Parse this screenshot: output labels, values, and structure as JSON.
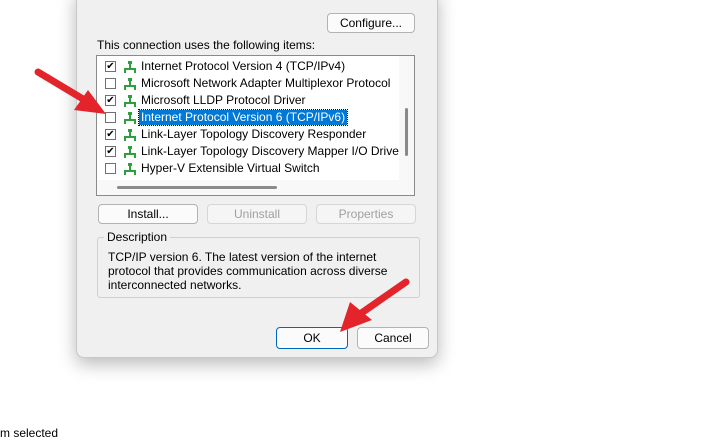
{
  "dialog": {
    "configure_label": "Configure...",
    "items_label": "This connection uses the following items:",
    "items": [
      {
        "label": "Internet Protocol Version 4 (TCP/IPv4)",
        "checked": true,
        "selected": false
      },
      {
        "label": "Microsoft Network Adapter Multiplexor Protocol",
        "checked": false,
        "selected": false
      },
      {
        "label": "Microsoft LLDP Protocol Driver",
        "checked": true,
        "selected": false
      },
      {
        "label": "Internet Protocol Version 6 (TCP/IPv6)",
        "checked": false,
        "selected": true
      },
      {
        "label": "Link-Layer Topology Discovery Responder",
        "checked": true,
        "selected": false
      },
      {
        "label": "Link-Layer Topology Discovery Mapper I/O Driver",
        "checked": true,
        "selected": false
      },
      {
        "label": "Hyper-V Extensible Virtual Switch",
        "checked": false,
        "selected": false
      }
    ],
    "install_label": "Install...",
    "uninstall_label": "Uninstall",
    "properties_label": "Properties",
    "description_title": "Description",
    "description_text": "TCP/IP version 6. The latest version of the internet protocol that provides communication across diverse interconnected networks.",
    "ok_label": "OK",
    "cancel_label": "Cancel"
  },
  "status_bar": {
    "text": "m selected"
  },
  "colors": {
    "selection": "#0078d7",
    "arrow": "#e3242b",
    "network_icon": "#2e9e3e"
  },
  "icons": {
    "network": "network-adapter-icon",
    "check": "checkmark-icon"
  }
}
